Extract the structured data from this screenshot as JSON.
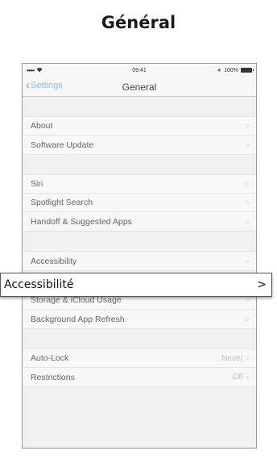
{
  "page_title": "Général",
  "status_bar": {
    "carrier": "•••••",
    "time": "09:41",
    "battery": "100%"
  },
  "nav": {
    "back_label": "Settings",
    "title": "General"
  },
  "groups": [
    {
      "rows": [
        {
          "label": "About"
        },
        {
          "label": "Software Update"
        }
      ]
    },
    {
      "rows": [
        {
          "label": "Siri"
        },
        {
          "label": "Spotlight Search"
        },
        {
          "label": "Handoff & Suggested Apps"
        }
      ]
    },
    {
      "rows": [
        {
          "label": "Accessibility"
        }
      ]
    },
    {
      "rows": [
        {
          "label": "Storage & iCloud Usage"
        },
        {
          "label": "Background App Refresh"
        }
      ]
    },
    {
      "rows": [
        {
          "label": "Auto-Lock",
          "value": "Never"
        },
        {
          "label": "Restrictions",
          "value": "Off"
        }
      ]
    }
  ],
  "callout": {
    "label": "Accessibilité",
    "chevron": ">"
  },
  "chevron_glyph": ">"
}
